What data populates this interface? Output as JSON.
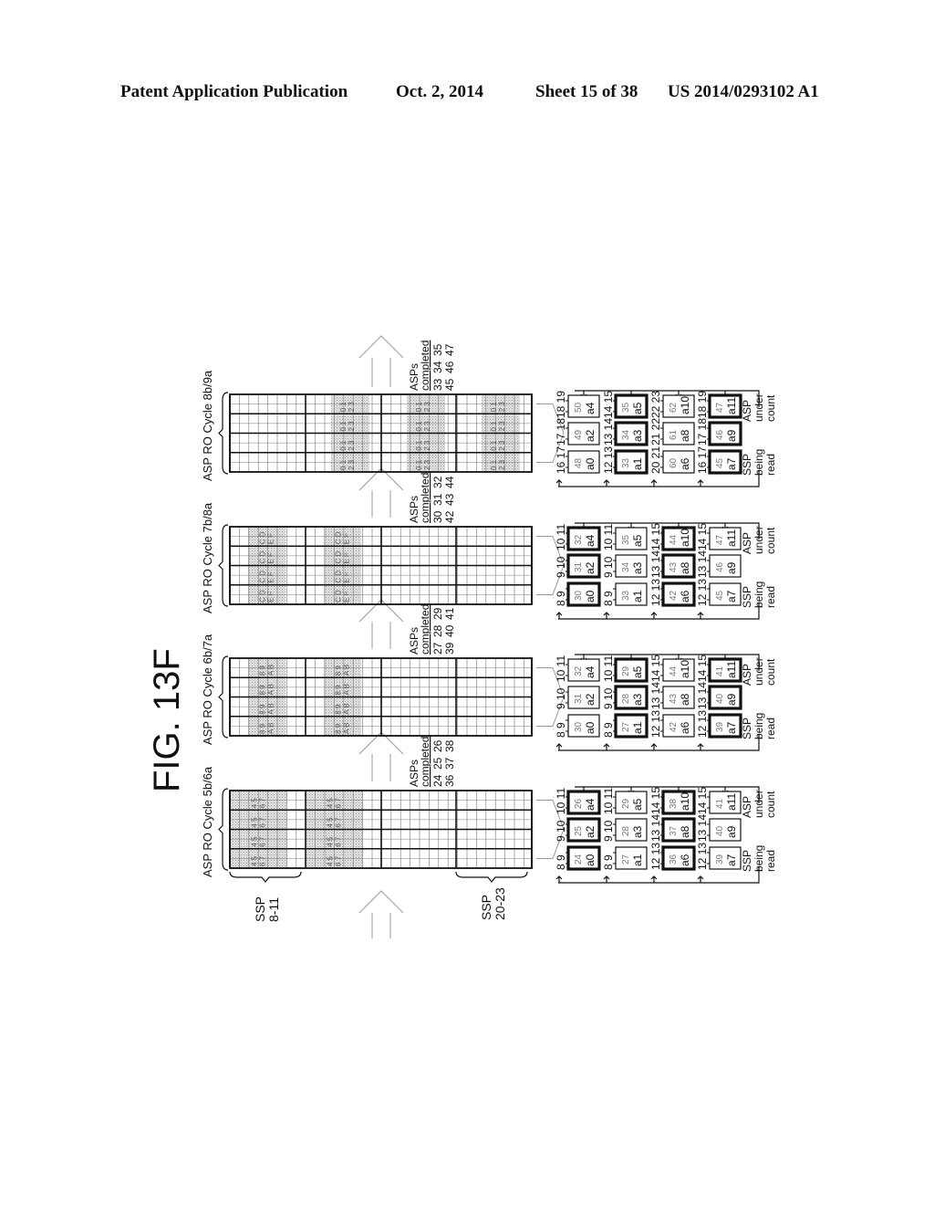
{
  "header": {
    "publication": "Patent Application Publication",
    "date": "Oct. 2, 2014",
    "sheet": "Sheet 15 of 38",
    "number": "US 2014/0293102 A1"
  },
  "figure": {
    "title": "FIG. 13F",
    "ssp_labels": [
      {
        "line1": "SSP",
        "line2": "8-11"
      },
      {
        "line1": "SSP",
        "line2": "20-23"
      }
    ],
    "asp_under_count_label": [
      "ASP",
      "under",
      "count"
    ],
    "ssp_being_read_label": [
      "SSP",
      "being",
      "read"
    ],
    "asps_completed_label": [
      "ASPs",
      "completed"
    ],
    "cycles": [
      {
        "title": "ASP RO Cycle 5b/6a",
        "shaded_sections": [
          0,
          1
        ],
        "cell_text": [
          "4 5 6 7",
          "4 5 6 7"
        ],
        "asps_completed": [
          [
            "24",
            "25",
            "26"
          ],
          [
            "36",
            "37",
            "38"
          ]
        ],
        "box_rows": [
          {
            "label_pairs": [
              "8 9",
              "8 9",
              "12 13",
              "12 13"
            ],
            "ids": [
              "24",
              "27",
              "36",
              "39"
            ],
            "names": [
              "a0",
              "a1",
              "a6",
              "a7"
            ],
            "bold": [
              true,
              false,
              true,
              false
            ]
          },
          {
            "label_pairs": [
              "9 10",
              "9 10",
              "13 14",
              "13 14"
            ],
            "ids": [
              "25",
              "28",
              "37",
              "40"
            ],
            "names": [
              "a2",
              "a3",
              "a8",
              "a9"
            ],
            "bold": [
              true,
              false,
              true,
              false
            ]
          },
          {
            "label_pairs": [
              "10 11",
              "10 11",
              "14 15",
              "14 15"
            ],
            "ids": [
              "26",
              "29",
              "38",
              "41"
            ],
            "names": [
              "a4",
              "a5",
              "a10",
              "a11"
            ],
            "bold": [
              true,
              false,
              true,
              false
            ]
          }
        ]
      },
      {
        "title": "ASP RO Cycle 6b/7a",
        "shaded_sections": [
          0,
          1
        ],
        "cell_text": [
          "8 9 A B",
          "8 9 A B"
        ],
        "asps_completed": [
          [
            "27",
            "28",
            "29"
          ],
          [
            "39",
            "40",
            "41"
          ]
        ],
        "box_rows": [
          {
            "label_pairs": [
              "8 9",
              "8 9",
              "12 13",
              "12 13"
            ],
            "ids": [
              "30",
              "27",
              "42",
              "39"
            ],
            "names": [
              "a0",
              "a1",
              "a6",
              "a7"
            ],
            "bold": [
              false,
              true,
              false,
              true
            ]
          },
          {
            "label_pairs": [
              "9 10",
              "9 10",
              "13 14",
              "13 14"
            ],
            "ids": [
              "31",
              "28",
              "43",
              "40"
            ],
            "names": [
              "a2",
              "a3",
              "a8",
              "a9"
            ],
            "bold": [
              false,
              true,
              false,
              true
            ]
          },
          {
            "label_pairs": [
              "10 11",
              "10 11",
              "14 15",
              "14 15"
            ],
            "ids": [
              "32",
              "29",
              "44",
              "41"
            ],
            "names": [
              "a4",
              "a5",
              "a10",
              "a11"
            ],
            "bold": [
              false,
              true,
              false,
              true
            ]
          }
        ]
      },
      {
        "title": "ASP RO Cycle 7b/8a",
        "shaded_sections": [
          0,
          1
        ],
        "cell_text": [
          "C D E F",
          "C D E F"
        ],
        "asps_completed": [
          [
            "30",
            "31",
            "32"
          ],
          [
            "42",
            "43",
            "44"
          ]
        ],
        "box_rows": [
          {
            "label_pairs": [
              "8 9",
              "8 9",
              "12 13",
              "12 13"
            ],
            "ids": [
              "30",
              "33",
              "42",
              "45"
            ],
            "names": [
              "a0",
              "a1",
              "a6",
              "a7"
            ],
            "bold": [
              true,
              false,
              true,
              false
            ]
          },
          {
            "label_pairs": [
              "9 10",
              "9 10",
              "13 14",
              "13 14"
            ],
            "ids": [
              "31",
              "34",
              "43",
              "46"
            ],
            "names": [
              "a2",
              "a3",
              "a8",
              "a9"
            ],
            "bold": [
              true,
              false,
              true,
              false
            ]
          },
          {
            "label_pairs": [
              "10 11",
              "10 11",
              "14 15",
              "14 15"
            ],
            "ids": [
              "32",
              "35",
              "44",
              "47"
            ],
            "names": [
              "a4",
              "a5",
              "a10",
              "a11"
            ],
            "bold": [
              true,
              false,
              true,
              false
            ]
          }
        ]
      },
      {
        "title": "ASP RO Cycle 8b/9a",
        "shaded_sections": [
          1,
          2,
          3
        ],
        "cell_text": [
          "0 1 2 3",
          "0 1 2 3",
          "0 1 2 3"
        ],
        "asps_completed": [
          [
            "33",
            "34",
            "35"
          ],
          [
            "45",
            "46",
            "47"
          ]
        ],
        "box_rows": [
          {
            "label_pairs": [
              "16 17",
              "12 13",
              "20 21",
              "16 17"
            ],
            "ids": [
              "48",
              "33",
              "60",
              "45"
            ],
            "names": [
              "a0",
              "a1",
              "a6",
              "a7"
            ],
            "bold": [
              false,
              true,
              false,
              true
            ]
          },
          {
            "label_pairs": [
              "17 18",
              "13 14",
              "21 22",
              "17 18"
            ],
            "ids": [
              "49",
              "34",
              "61",
              "46"
            ],
            "names": [
              "a2",
              "a3",
              "a8",
              "a9"
            ],
            "bold": [
              false,
              true,
              false,
              true
            ]
          },
          {
            "label_pairs": [
              "18 19",
              "14 15",
              "22 23",
              "18 19"
            ],
            "ids": [
              "50",
              "35",
              "62",
              "47"
            ],
            "names": [
              "a4",
              "a5",
              "a10",
              "a11"
            ],
            "bold": [
              false,
              true,
              false,
              true
            ]
          }
        ]
      }
    ]
  }
}
